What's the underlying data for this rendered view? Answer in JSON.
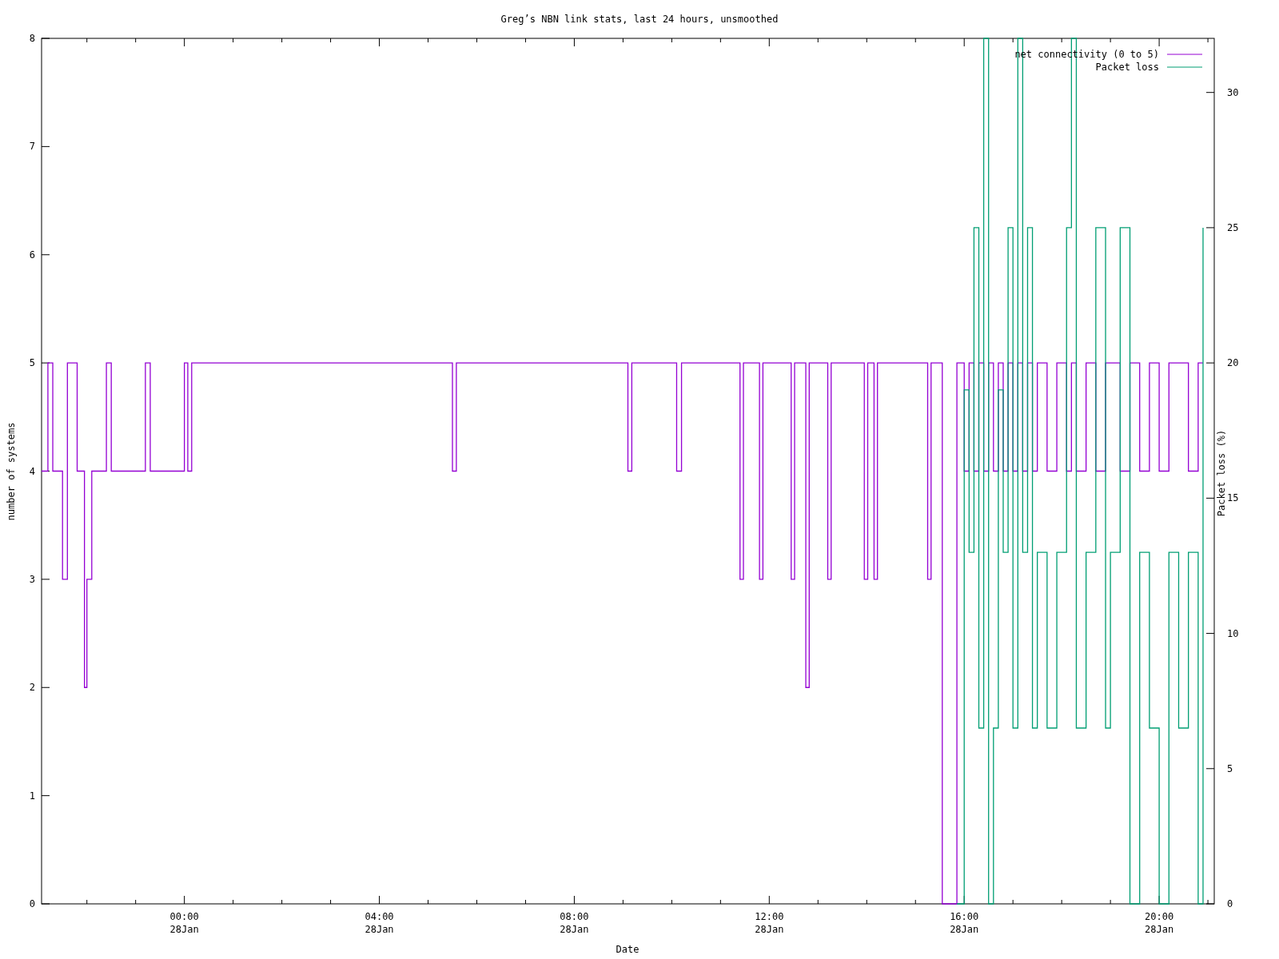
{
  "chart_data": {
    "type": "line",
    "title": "Greg’s NBN link stats, last 24 hours, unsmoothed",
    "xlabel": "Date",
    "ylabel": "number of systems",
    "y2label": "Packet loss (%)",
    "legend": true,
    "xlim": [
      -2.93,
      21.13
    ],
    "ylim": [
      0,
      8
    ],
    "y2lim": [
      0,
      32
    ],
    "xticks": [
      {
        "value": 0,
        "label": "00:00"
      },
      {
        "value": 4,
        "label": "04:00"
      },
      {
        "value": 8,
        "label": "08:00"
      },
      {
        "value": 12,
        "label": "12:00"
      },
      {
        "value": 16,
        "label": "16:00"
      },
      {
        "value": 20,
        "label": "20:00"
      }
    ],
    "annotations": [
      "28Jan",
      "28Jan",
      "28Jan",
      "28Jan",
      "28Jan",
      "28Jan"
    ],
    "yticks": [
      0,
      1,
      2,
      3,
      4,
      5,
      6,
      7,
      8
    ],
    "y2ticks": [
      0,
      5,
      10,
      15,
      20,
      25,
      30
    ],
    "x": [
      -2.93,
      -2.8,
      -2.8,
      -2.7,
      -2.7,
      -2.5,
      -2.5,
      -2.4,
      -2.4,
      -2.2,
      -2.2,
      -2.05,
      -2.05,
      -2.0,
      -2.0,
      -1.9,
      -1.9,
      -1.6,
      -1.6,
      -1.5,
      -1.5,
      -0.8,
      -0.8,
      -0.7,
      -0.7,
      0,
      0,
      0.07,
      0.07,
      0.15,
      0.15,
      5.5,
      5.5,
      5.58,
      5.58,
      9.1,
      9.1,
      9.18,
      9.18,
      10.1,
      10.1,
      10.2,
      10.2,
      11.4,
      11.4,
      11.47,
      11.47,
      11.8,
      11.8,
      11.87,
      11.87,
      12.45,
      12.45,
      12.52,
      12.52,
      12.75,
      12.75,
      12.82,
      12.82,
      13.2,
      13.2,
      13.27,
      13.27,
      13.95,
      13.95,
      14.02,
      14.02,
      14.15,
      14.15,
      14.22,
      14.22,
      15.25,
      15.25,
      15.32,
      15.32,
      15.55,
      15.55,
      15.85,
      15.85,
      16.0,
      16.0,
      16.1,
      16.1,
      16.2,
      16.2,
      16.3,
      16.3,
      16.4,
      16.4,
      16.5,
      16.5,
      16.6,
      16.6,
      16.7,
      16.7,
      16.8,
      16.8,
      16.9,
      16.9,
      17.0,
      17.0,
      17.1,
      17.1,
      17.2,
      17.2,
      17.3,
      17.3,
      17.4,
      17.4,
      17.5,
      17.5,
      17.7,
      17.7,
      17.9,
      17.9,
      18.1,
      18.1,
      18.2,
      18.2,
      18.3,
      18.3,
      18.5,
      18.5,
      18.7,
      18.7,
      18.9,
      18.9,
      19.0,
      19.0,
      19.2,
      19.2,
      19.4,
      19.4,
      19.6,
      19.6,
      19.8,
      19.8,
      20.0,
      20.0,
      20.2,
      20.2,
      20.4,
      20.4,
      20.6,
      20.6,
      20.8,
      20.8,
      20.9,
      20.9
    ],
    "series": [
      {
        "name": "net connectivity (0 to 5)",
        "color": "#9400d3",
        "axis": "y",
        "values": [
          4,
          4,
          5,
          5,
          4,
          4,
          3,
          3,
          5,
          5,
          4,
          4,
          2,
          2,
          3,
          3,
          4,
          4,
          5,
          5,
          4,
          4,
          5,
          5,
          4,
          4,
          5,
          5,
          4,
          4,
          5,
          5,
          4,
          4,
          5,
          5,
          4,
          4,
          5,
          5,
          4,
          4,
          5,
          5,
          3,
          3,
          5,
          5,
          3,
          3,
          5,
          5,
          3,
          3,
          5,
          5,
          2,
          2,
          5,
          5,
          3,
          3,
          5,
          5,
          3,
          3,
          5,
          5,
          3,
          3,
          5,
          5,
          3,
          3,
          5,
          5,
          0,
          0,
          5,
          5,
          4,
          4,
          5,
          5,
          4,
          4,
          5,
          5,
          4,
          4,
          5,
          5,
          4,
          4,
          5,
          5,
          4,
          4,
          5,
          5,
          4,
          4,
          5,
          5,
          4,
          4,
          5,
          5,
          4,
          4,
          5,
          5,
          4,
          4,
          5,
          5,
          4,
          4,
          5,
          5,
          4,
          4,
          5,
          5,
          4,
          4,
          5,
          5,
          5,
          5,
          4,
          4,
          5,
          5,
          4,
          4,
          5,
          5,
          4,
          4,
          5,
          5,
          5,
          5,
          4,
          4,
          5,
          5,
          5
        ]
      },
      {
        "name": "Packet loss",
        "color": "#009e73",
        "axis": "y2",
        "values": [
          null,
          null,
          null,
          null,
          null,
          null,
          null,
          null,
          null,
          null,
          null,
          null,
          null,
          null,
          null,
          null,
          null,
          null,
          null,
          null,
          null,
          null,
          null,
          null,
          null,
          null,
          null,
          null,
          null,
          null,
          null,
          null,
          null,
          null,
          null,
          null,
          null,
          null,
          null,
          null,
          null,
          null,
          null,
          null,
          null,
          null,
          null,
          null,
          null,
          null,
          null,
          null,
          null,
          null,
          null,
          null,
          null,
          null,
          null,
          null,
          null,
          null,
          null,
          null,
          null,
          null,
          null,
          null,
          null,
          null,
          null,
          null,
          null,
          null,
          null,
          null,
          null,
          null,
          0,
          0,
          19,
          19,
          13,
          13,
          25,
          25,
          6.5,
          6.5,
          32,
          32,
          0,
          0,
          6.5,
          6.5,
          19,
          19,
          13,
          13,
          25,
          25,
          6.5,
          6.5,
          32,
          32,
          13,
          13,
          25,
          25,
          6.5,
          6.5,
          13,
          13,
          6.5,
          6.5,
          13,
          13,
          25,
          25,
          32,
          32,
          6.5,
          6.5,
          13,
          13,
          25,
          25,
          6.5,
          6.5,
          13,
          13,
          25,
          25,
          0,
          0,
          13,
          13,
          6.5,
          6.5,
          0,
          0,
          13,
          13,
          6.5,
          6.5,
          13,
          13,
          0,
          0,
          25
        ]
      }
    ]
  }
}
